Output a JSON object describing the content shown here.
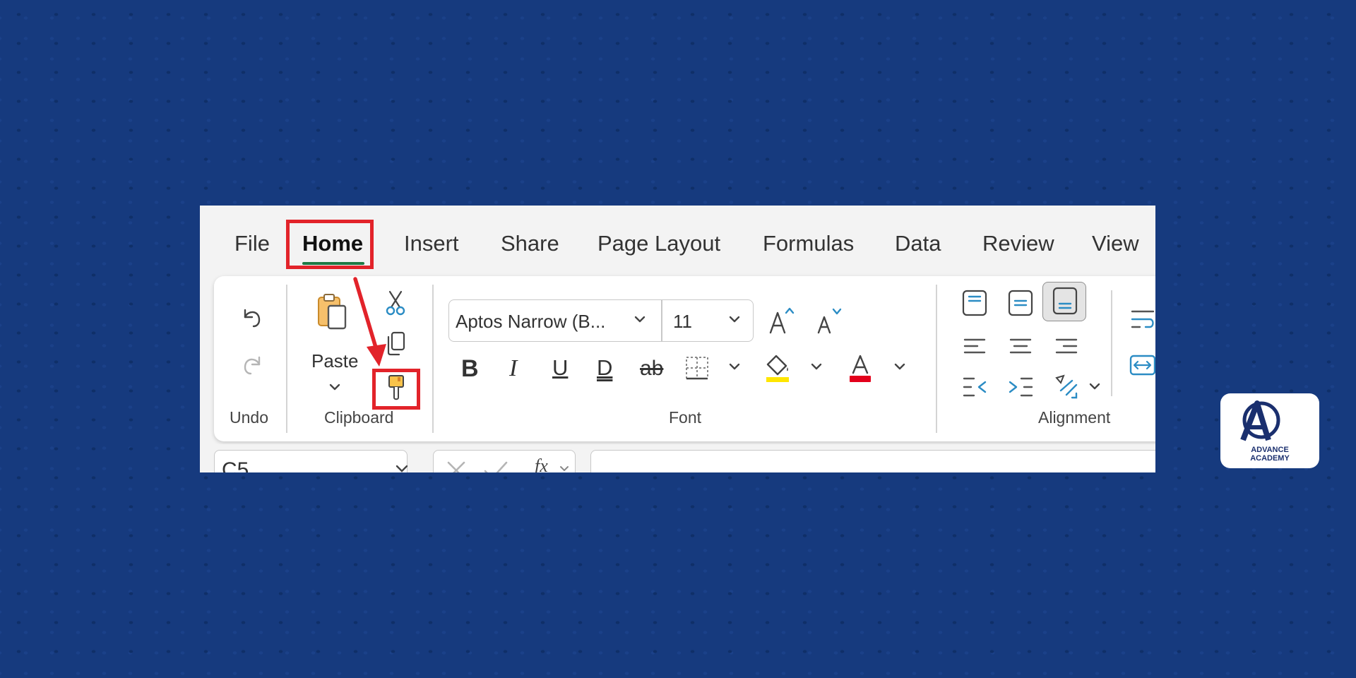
{
  "tabs": [
    {
      "label": "File"
    },
    {
      "label": "Home"
    },
    {
      "label": "Insert"
    },
    {
      "label": "Share"
    },
    {
      "label": "Page Layout"
    },
    {
      "label": "Formulas"
    },
    {
      "label": "Data"
    },
    {
      "label": "Review"
    },
    {
      "label": "View"
    }
  ],
  "active_tab": "Home",
  "clipboard": {
    "paste_label": "Paste"
  },
  "font": {
    "family_value": "Aptos Narrow (B...",
    "size_value": "11"
  },
  "formula_bar": {
    "name_box_value": "C5",
    "fx_label": "fx"
  },
  "groups": {
    "undo": "Undo",
    "clipboard": "Clipboard",
    "font": "Font",
    "alignment": "Alignment"
  },
  "format_toggles": {
    "bold": "B",
    "italic": "I",
    "underline": "U",
    "double_underline": "D",
    "strikethrough": "ab"
  },
  "logo": {
    "line1": "ADVANCE",
    "line2": "ACADEMY"
  },
  "colors": {
    "highlight": "#e2232a",
    "accent": "#1e7a44",
    "background": "#163a7e",
    "fill_color": "#ffe600",
    "font_color": "#e3001b"
  }
}
